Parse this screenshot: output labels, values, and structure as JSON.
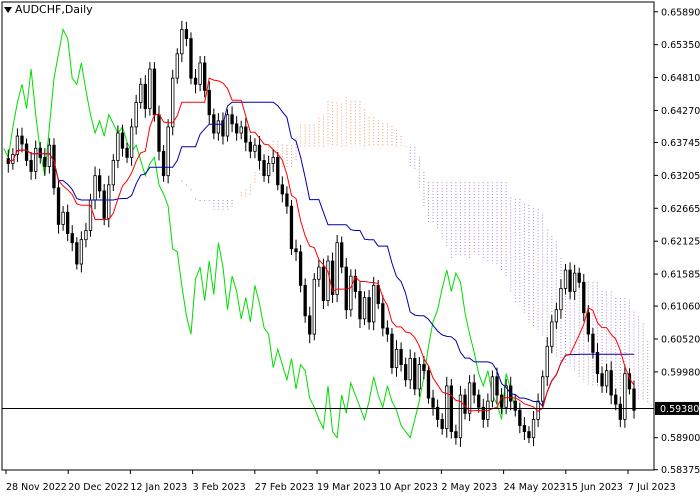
{
  "header": {
    "symbol_label": "AUDCHF,Daily"
  },
  "current_price_label": "0.59380",
  "chart_data": {
    "type": "line",
    "title": "AUDCHF,Daily",
    "ylim": [
      0.5837,
      0.6605
    ],
    "y_ticks": [
      "0.65890",
      "0.65350",
      "0.64810",
      "0.64270",
      "0.63745",
      "0.63205",
      "0.62665",
      "0.62125",
      "0.61585",
      "0.61060",
      "0.60520",
      "0.59980",
      "0.59380",
      "0.58900",
      "0.58375"
    ],
    "x_ticks": [
      "28 Nov 2022",
      "20 Dec 2022",
      "12 Jan 2023",
      "3 Feb 2023",
      "27 Feb 2023",
      "19 Mar 2023",
      "10 Apr 2023",
      "2 May 2023",
      "24 May 2023",
      "15 Jun 2023",
      "7 Jul 2023"
    ],
    "current_price": 0.5938,
    "grid": false,
    "colors": {
      "candle": "#000000",
      "tenkan": "#ff0000",
      "kijun": "#0000aa",
      "chikou": "#00dd00",
      "cloud_bull": "#ee9966",
      "cloud_bear": "#aa88cc",
      "price_line": "#000000"
    },
    "series": [
      {
        "name": "close",
        "values": [
          0.634,
          0.6355,
          0.6385,
          0.6372,
          0.6345,
          0.6327,
          0.6365,
          0.635,
          0.6335,
          0.637,
          0.63,
          0.624,
          0.626,
          0.6225,
          0.621,
          0.6175,
          0.6215,
          0.623,
          0.628,
          0.632,
          0.6295,
          0.625,
          0.6305,
          0.6345,
          0.639,
          0.6365,
          0.635,
          0.64,
          0.644,
          0.647,
          0.643,
          0.6495,
          0.642,
          0.636,
          0.632,
          0.64,
          0.648,
          0.652,
          0.656,
          0.6545,
          0.648,
          0.647,
          0.6505,
          0.646,
          0.642,
          0.639,
          0.641,
          0.6385,
          0.642,
          0.6405,
          0.639,
          0.64,
          0.6375,
          0.636,
          0.637,
          0.6345,
          0.632,
          0.634,
          0.635,
          0.6305,
          0.629,
          0.627,
          0.62,
          0.6195,
          0.614,
          0.609,
          0.606,
          0.615,
          0.617,
          0.6115,
          0.618,
          0.6125,
          0.621,
          0.617,
          0.61,
          0.6155,
          0.613,
          0.6085,
          0.612,
          0.608,
          0.614,
          0.611,
          0.607,
          0.606,
          0.6005,
          0.6035,
          0.601,
          0.5985,
          0.602,
          0.597,
          0.601,
          0.6,
          0.5955,
          0.594,
          0.592,
          0.5905,
          0.5975,
          0.59,
          0.589,
          0.596,
          0.593,
          0.598,
          0.596,
          0.594,
          0.592,
          0.595,
          0.599,
          0.596,
          0.594,
          0.5975,
          0.595,
          0.5935,
          0.591,
          0.59,
          0.589,
          0.592,
          0.595,
          0.599,
          0.604,
          0.608,
          0.61,
          0.6135,
          0.6165,
          0.613,
          0.616,
          0.6145,
          0.6095,
          0.606,
          0.603,
          0.5995,
          0.5975,
          0.6,
          0.596,
          0.5945,
          0.592,
          0.5995,
          0.597,
          0.5935
        ]
      }
    ]
  }
}
